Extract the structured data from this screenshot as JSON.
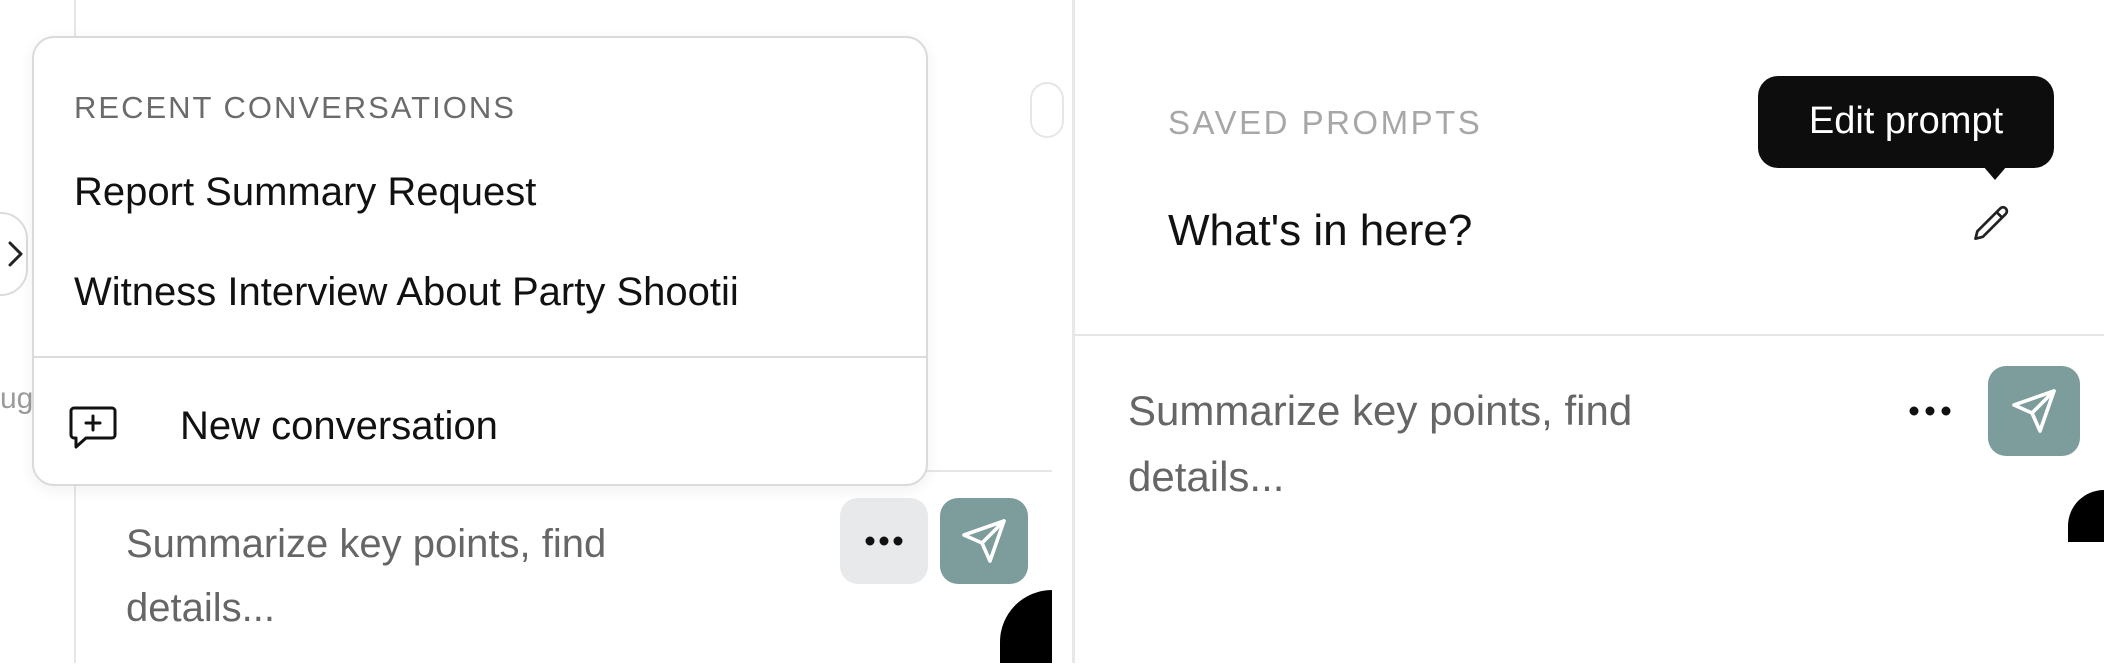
{
  "left": {
    "cut_text": "ug",
    "composer": {
      "placeholder": "Summarize key points, find details..."
    },
    "dropdown": {
      "heading": "RECENT CONVERSATIONS",
      "items": [
        {
          "label": "Report Summary Request"
        },
        {
          "label": "Witness Interview About Party Shootii"
        }
      ],
      "new_conversation_label": "New conversation"
    }
  },
  "right": {
    "heading": "SAVED PROMPTS",
    "prompts": [
      {
        "label": "What's in here?"
      }
    ],
    "tooltip": "Edit prompt",
    "composer": {
      "placeholder": "Summarize key points, find details..."
    }
  },
  "colors": {
    "send_button": "#7d9c9c",
    "more_button_active": "#e8e9eb",
    "tooltip_bg": "#0d0d0d"
  },
  "icons": [
    "chevron-right-icon",
    "more-horizontal-icon",
    "send-icon",
    "new-message-icon",
    "pencil-icon"
  ]
}
